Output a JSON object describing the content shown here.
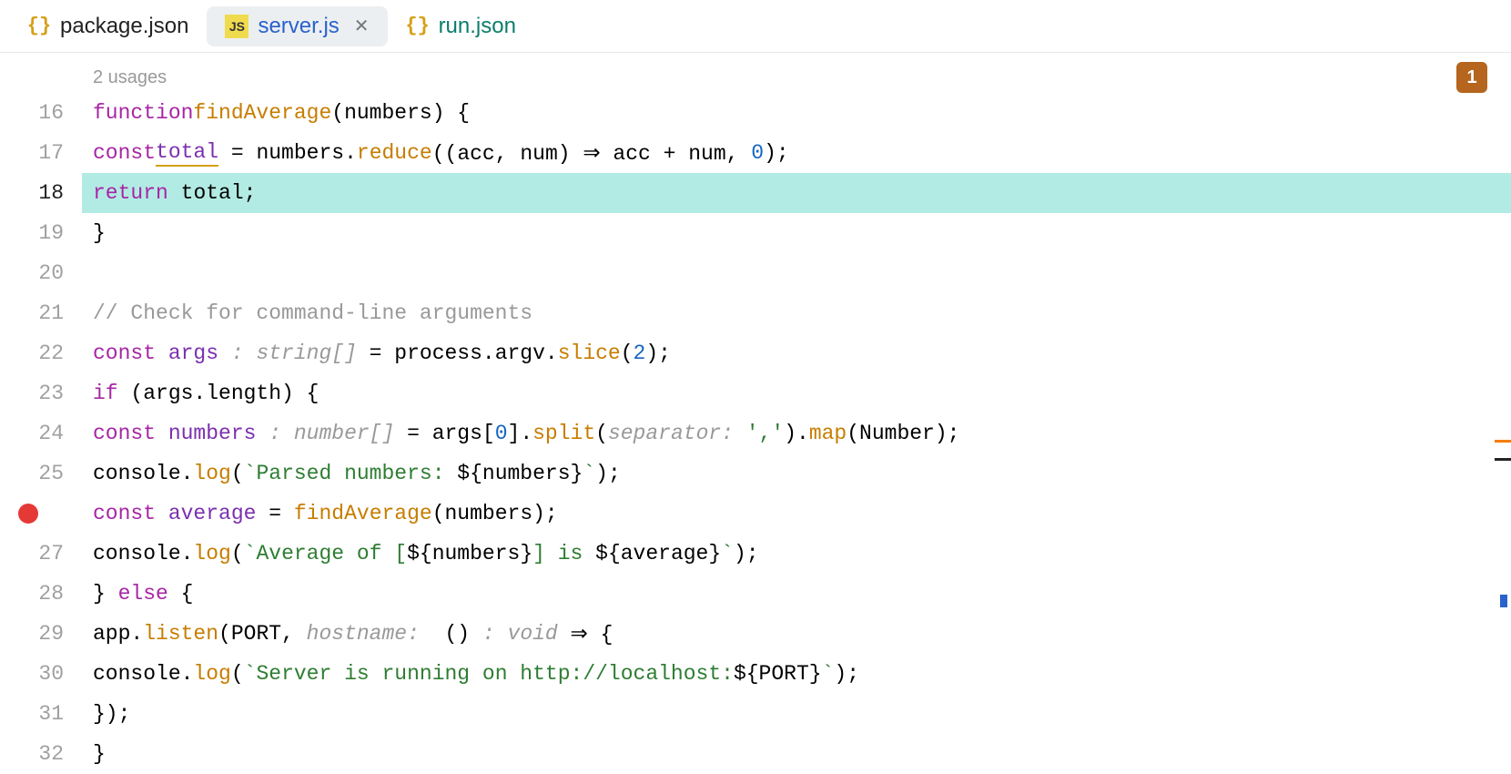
{
  "tabs": [
    {
      "label": "package.json",
      "icon": "json",
      "active": false
    },
    {
      "label": "server.js",
      "icon": "js",
      "active": true,
      "closable": true
    },
    {
      "label": "run.json",
      "icon": "json",
      "active": false
    }
  ],
  "badge": {
    "count": "1"
  },
  "usage_hint": "2 usages",
  "gutter": {
    "start": 16,
    "end": 32,
    "highlighted": 18,
    "breakpoint": 26
  },
  "code": {
    "l16": {
      "kw_function": "function",
      "fn": "findAverage",
      "param": "numbers",
      "brace": " {"
    },
    "l17": {
      "kw_const": "const",
      "var_total": "total",
      "eq": " = ",
      "obj": "numbers",
      "dot": ".",
      "method": "reduce",
      "args": "((acc, num) ⇒ acc + num, ",
      "zero": "0",
      "close": ");"
    },
    "l18": {
      "kw_return": "return",
      "sp": " ",
      "var": "total",
      "semi": ";"
    },
    "l19": {
      "brace": "}"
    },
    "l21": {
      "comment": "// Check for command-line arguments"
    },
    "l22": {
      "kw_const": "const",
      "sp": " ",
      "var": "args",
      "hint": " : string[]",
      "eq": " = process.argv.",
      "method": "slice",
      "open": "(",
      "num": "2",
      "close": ");"
    },
    "l23": {
      "kw_if": "if",
      "cond": " (args.length) {"
    },
    "l24": {
      "kw_const": "const",
      "sp": " ",
      "var": "numbers",
      "hint": " : number[]",
      "eq": " = args[",
      "idx": "0",
      "mid": "].",
      "method": "split",
      "open": "(",
      "hint2": "separator: ",
      "str": "','",
      "mid2": ").",
      "method2": "map",
      "tail": "(Number);"
    },
    "l25": {
      "obj": "console.",
      "method": "log",
      "open": "(",
      "str1": "`Parsed numbers: ",
      "interp": "${numbers}",
      "str2": "`",
      "close": ");"
    },
    "l26": {
      "kw_const": "const",
      "sp": " ",
      "var": "average",
      "eq": " = ",
      "fn": "findAverage",
      "args": "(numbers);"
    },
    "l27": {
      "obj": "console.",
      "method": "log",
      "open": "(",
      "str1": "`Average of [",
      "interp1": "${numbers}",
      "str2": "] is ",
      "interp2": "${average}",
      "str3": "`",
      "close": ");"
    },
    "l28": {
      "close": "}",
      "sp": " ",
      "kw_else": "else",
      "open": " {"
    },
    "l29": {
      "obj": "app.",
      "method": "listen",
      "args1": "(PORT, ",
      "hint": "hostname: ",
      "args2": " () ",
      "hint2": ": void",
      "arrow": " ⇒ {"
    },
    "l30": {
      "obj": "console.",
      "method": "log",
      "open": "(",
      "str1": "`Server is running on http://localhost:",
      "interp": "${PORT}",
      "str2": "`",
      "close": ");"
    },
    "l31": {
      "close": "});"
    },
    "l32": {
      "close": "}"
    }
  }
}
